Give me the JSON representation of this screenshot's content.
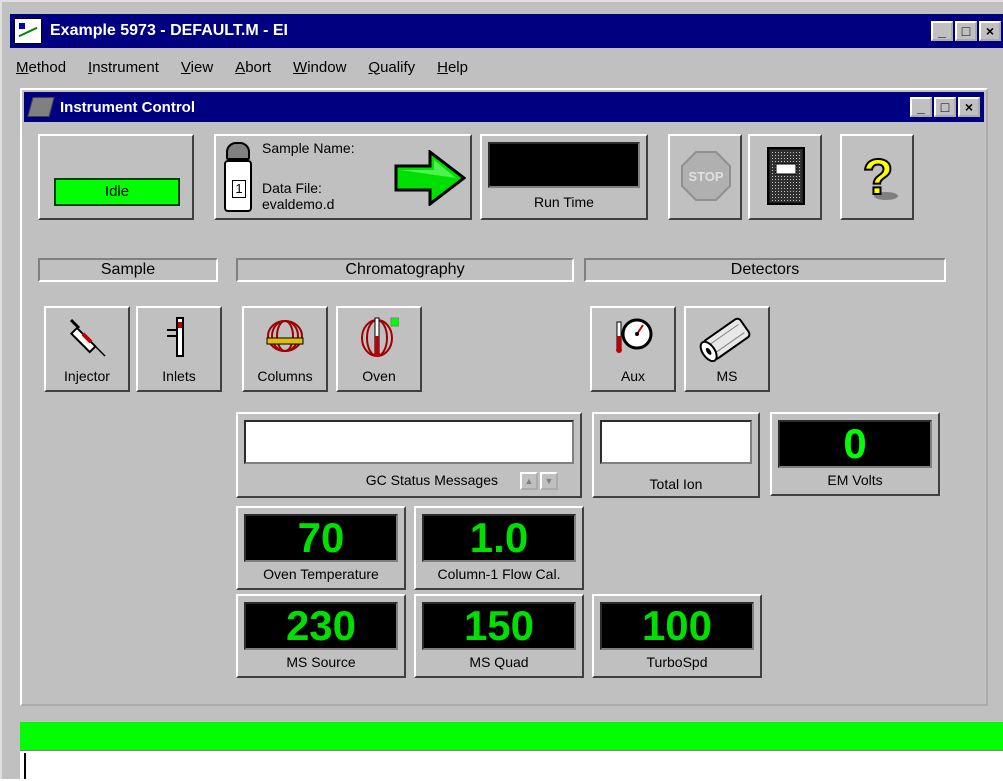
{
  "app": {
    "title": "Example 5973 - DEFAULT.M - EI",
    "window_buttons": [
      "_",
      "□",
      "×"
    ]
  },
  "menu": {
    "items": [
      "Method",
      "Instrument",
      "View",
      "Abort",
      "Window",
      "Qualify",
      "Help"
    ]
  },
  "instrument_control": {
    "title": "Instrument Control",
    "status": "Idle",
    "sample_name_label": "Sample Name:",
    "vial_number": "1",
    "data_file_label": "Data File:",
    "data_file_value": "evaldemo.d",
    "run_time_label": "Run Time",
    "run_time_value": ""
  },
  "groups": {
    "sample": "Sample",
    "chromatography": "Chromatography",
    "detectors": "Detectors"
  },
  "buttons": {
    "injector": "Injector",
    "inlets": "Inlets",
    "columns": "Columns",
    "oven": "Oven",
    "aux": "Aux",
    "ms": "MS"
  },
  "monitors": {
    "gc_status_label": "GC Status Messages",
    "gc_status_value": "",
    "total_ion_label": "Total Ion",
    "total_ion_value": "",
    "em_volts_label": "EM Volts",
    "em_volts_value": "0",
    "oven_temp_label": "Oven Temperature",
    "oven_temp_value": "70",
    "column_flow_label": "Column-1 Flow Cal.",
    "column_flow_value": "1.0",
    "ms_source_label": "MS Source",
    "ms_source_value": "230",
    "ms_quad_label": "MS Quad",
    "ms_quad_value": "150",
    "turbo_label": "TurboSpd",
    "turbo_value": "100"
  },
  "colors": {
    "title_bar": "#000080",
    "face": "#c0c0c0",
    "led_green": "#00ff00",
    "readout_green": "#00e000"
  }
}
